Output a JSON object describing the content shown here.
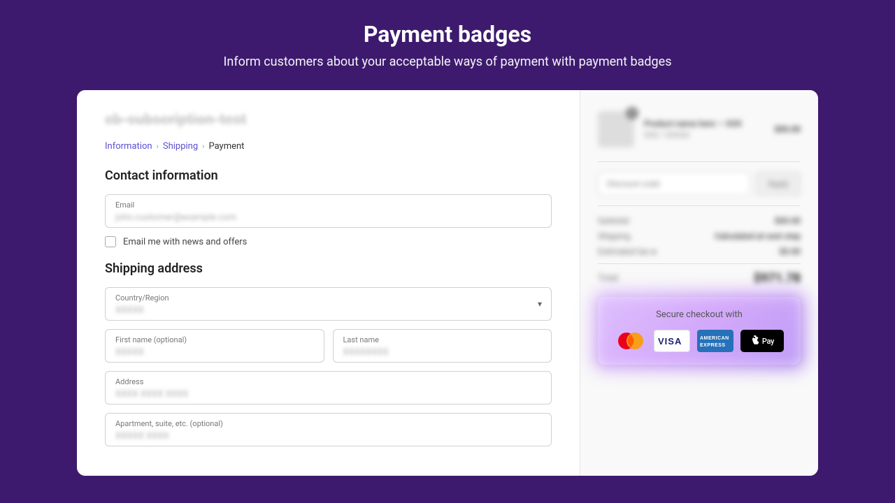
{
  "header": {
    "title": "Payment badges",
    "subtitle": "Inform customers about your acceptable ways of payment with payment badges"
  },
  "storeName": "cb-subscription-test",
  "breadcrumb": {
    "items": [
      "Information",
      "Shipping",
      "Payment"
    ]
  },
  "contactSection": {
    "title": "Contact information",
    "emailLabel": "Email",
    "emailValue": "john.customer@example.com",
    "checkboxLabel": "Email me with news and offers"
  },
  "shippingSection": {
    "title": "Shipping address",
    "countryLabel": "Country/Region",
    "countryValue": "XXXXX",
    "firstNameLabel": "First name (optional)",
    "firstNameValue": "XXXXX",
    "lastNameLabel": "Last name",
    "lastNameValue": "XXXXXXXX",
    "addressLabel": "Address",
    "addressValue": "XXXX XXXX XXXX",
    "aptLabel": "Apartment, suite, etc. (optional)",
    "aptValue": "XXXXX XXXX"
  },
  "orderSummary": {
    "discountPlaceholder": "Discount code",
    "discountButton": "Apply",
    "rows": [
      {
        "label": "Subtotal",
        "value": "$00.00"
      },
      {
        "label": "Shipping",
        "value": "Calculated at next step"
      },
      {
        "label": "Estimated tax ●",
        "value": "$0.00"
      }
    ],
    "total": {
      "label": "Total",
      "value": "$971.78"
    }
  },
  "secureCheckout": {
    "title": "Secure checkout with",
    "badges": [
      "Mastercard",
      "Visa",
      "American Express",
      "Apple Pay"
    ]
  }
}
